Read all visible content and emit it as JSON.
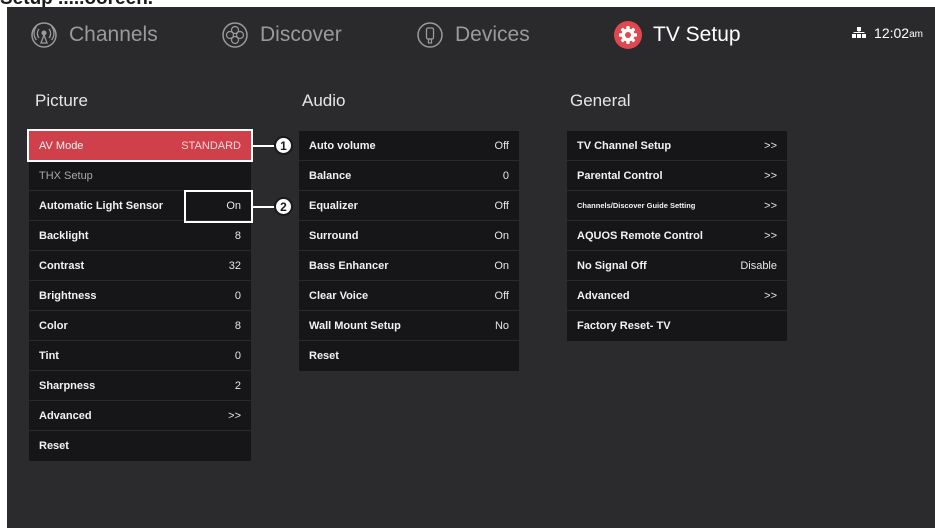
{
  "caption": "Setup .....ooreen.",
  "nav": {
    "tabs": [
      {
        "label": "Channels",
        "icon": "channels-icon"
      },
      {
        "label": "Discover",
        "icon": "discover-icon"
      },
      {
        "label": "Devices",
        "icon": "devices-icon"
      },
      {
        "label": "TV Setup",
        "icon": "tv-setup-gear-icon",
        "active": true
      }
    ],
    "clock": {
      "time": "12:02",
      "ampm": "am",
      "icon": "network-icon"
    }
  },
  "colors": {
    "accent": "#d0404a",
    "gear": "#e0484f"
  },
  "sections": {
    "picture": {
      "title": "Picture",
      "items": [
        {
          "label": "AV Mode",
          "value": "STANDARD"
        },
        {
          "label": "THX Setup",
          "value": ""
        },
        {
          "label": "Automatic Light Sensor",
          "value": "On"
        },
        {
          "label": "Backlight",
          "value": "8"
        },
        {
          "label": "Contrast",
          "value": "32"
        },
        {
          "label": "Brightness",
          "value": "0"
        },
        {
          "label": "Color",
          "value": "8"
        },
        {
          "label": "Tint",
          "value": "0"
        },
        {
          "label": "Sharpness",
          "value": "2"
        },
        {
          "label": "Advanced",
          "value": ">>"
        },
        {
          "label": "Reset",
          "value": ""
        }
      ]
    },
    "audio": {
      "title": "Audio",
      "items": [
        {
          "label": "Auto volume",
          "value": "Off"
        },
        {
          "label": "Balance",
          "value": "0"
        },
        {
          "label": "Equalizer",
          "value": "Off"
        },
        {
          "label": "Surround",
          "value": "On"
        },
        {
          "label": "Bass Enhancer",
          "value": "On"
        },
        {
          "label": "Clear Voice",
          "value": "Off"
        },
        {
          "label": "Wall Mount Setup",
          "value": "No"
        },
        {
          "label": "Reset",
          "value": ""
        }
      ]
    },
    "general": {
      "title": "General",
      "items": [
        {
          "label": "TV Channel Setup",
          "value": ">>"
        },
        {
          "label": "Parental Control",
          "value": ">>"
        },
        {
          "label": "Channels/Discover Guide Setting",
          "value": ">>"
        },
        {
          "label": "AQUOS Remote Control",
          "value": ">>"
        },
        {
          "label": "No Signal Off",
          "value": "Disable"
        },
        {
          "label": "Advanced",
          "value": ">>"
        },
        {
          "label": "Factory Reset- TV",
          "value": ""
        }
      ]
    }
  },
  "callouts": {
    "one": "1",
    "two": "2"
  }
}
